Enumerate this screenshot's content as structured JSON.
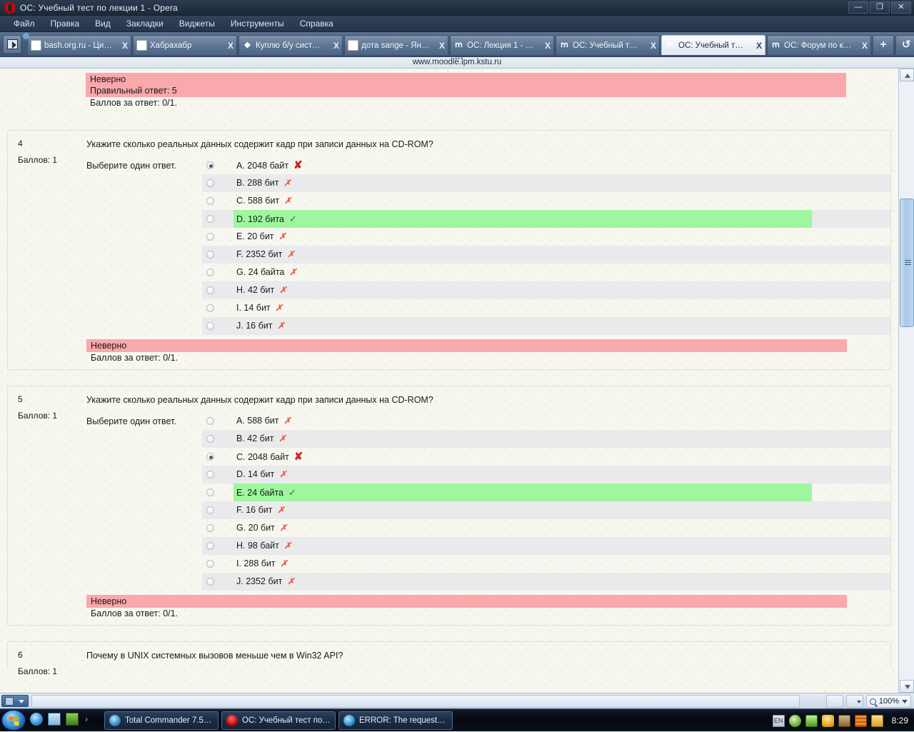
{
  "window": {
    "title": "ОС: Учебный тест по лекции 1 - Opera",
    "minimize": "—",
    "maximize": "❐",
    "close": "✕"
  },
  "menubar": [
    "Файл",
    "Правка",
    "Вид",
    "Закладки",
    "Виджеты",
    "Инструменты",
    "Справка"
  ],
  "tabs": [
    {
      "favicon": "b",
      "favclass": "fav-bash",
      "label": "bash.org.ru - Ци…",
      "close": "X",
      "active": false
    },
    {
      "favicon": "H",
      "favclass": "fav-habr",
      "label": "Хабрахабр",
      "close": "X",
      "active": false
    },
    {
      "favicon": "◆",
      "favclass": "fav-blue",
      "label": "Куплю б/у сист…",
      "close": "X",
      "active": false
    },
    {
      "favicon": "Я",
      "favclass": "fav-ya",
      "label": "дота sange - Ян…",
      "close": "X",
      "active": false
    },
    {
      "favicon": "ⅿ",
      "favclass": "fav-moodle",
      "label": "ОС: Лекция 1 - …",
      "close": "X",
      "active": false
    },
    {
      "favicon": "ⅿ",
      "favclass": "fav-moodle",
      "label": "ОС: Учебный т…",
      "close": "X",
      "active": false
    },
    {
      "favicon": "ⅿ",
      "favclass": "fav-moodle",
      "label": "ОС: Учебный т…",
      "close": "X",
      "active": true
    },
    {
      "favicon": "ⅿ",
      "favclass": "fav-moodle",
      "label": "ОС: Форум по к…",
      "close": "X",
      "active": false
    }
  ],
  "tab_controls": {
    "new_tab": "+",
    "trash": "↺",
    "panel_toggle": "panel-icon"
  },
  "address": {
    "url": "www.moodle.ipm.kstu.ru",
    "dots": "•••"
  },
  "quiz": {
    "labels": {
      "grade_prefix": "Баллов:",
      "choose_one": "Выберите один ответ.",
      "incorrect": "Неверно",
      "correct_answer_prefix": "Правильный ответ:",
      "points_prefix": "Баллов за ответ:"
    },
    "previous_feedback": {
      "verdict": "Неверно",
      "correct_answer": "Правильный ответ: 5",
      "points": "Баллов за ответ: 0/1."
    },
    "questions": [
      {
        "number": "4",
        "grade": "Баллов: 1",
        "text": "Укажите сколько реальных данных содержит кадр при записи данных на CD-ROM?",
        "choose_label": "Выберите один ответ.",
        "options": [
          {
            "label": "A. 2048 байт",
            "selected": true,
            "state": "wrong-big",
            "mark": "✘",
            "shaded": false
          },
          {
            "label": "B. 288 бит",
            "selected": false,
            "state": "wrong-sm",
            "mark": "✗",
            "shaded": true
          },
          {
            "label": "C. 588 бит",
            "selected": false,
            "state": "wrong-sm",
            "mark": "✗",
            "shaded": false
          },
          {
            "label": "D. 192 бита",
            "selected": false,
            "state": "correct",
            "mark": "✓",
            "shaded": true
          },
          {
            "label": "E. 20 бит",
            "selected": false,
            "state": "wrong-sm",
            "mark": "✗",
            "shaded": false
          },
          {
            "label": "F. 2352 бит",
            "selected": false,
            "state": "wrong-sm",
            "mark": "✗",
            "shaded": true
          },
          {
            "label": "G. 24 байта",
            "selected": false,
            "state": "wrong-sm",
            "mark": "✗",
            "shaded": false
          },
          {
            "label": "H. 42 бит",
            "selected": false,
            "state": "wrong-sm",
            "mark": "✗",
            "shaded": true
          },
          {
            "label": "I. 14 бит",
            "selected": false,
            "state": "wrong-sm",
            "mark": "✗",
            "shaded": false
          },
          {
            "label": "J. 16 бит",
            "selected": false,
            "state": "wrong-sm",
            "mark": "✗",
            "shaded": true
          }
        ],
        "feedback": {
          "verdict": "Неверно",
          "points": "Баллов за ответ: 0/1."
        }
      },
      {
        "number": "5",
        "grade": "Баллов: 1",
        "text": "Укажите сколько реальных данных содержит кадр при записи данных на CD-ROM?",
        "choose_label": "Выберите один ответ.",
        "options": [
          {
            "label": "A. 588 бит",
            "selected": false,
            "state": "wrong-sm",
            "mark": "✗",
            "shaded": false
          },
          {
            "label": "B. 42 бит",
            "selected": false,
            "state": "wrong-sm",
            "mark": "✗",
            "shaded": true
          },
          {
            "label": "C. 2048 байт",
            "selected": true,
            "state": "wrong-big",
            "mark": "✘",
            "shaded": false
          },
          {
            "label": "D. 14 бит",
            "selected": false,
            "state": "wrong-sm",
            "mark": "✗",
            "shaded": true
          },
          {
            "label": "E. 24 байта",
            "selected": false,
            "state": "correct",
            "mark": "✓",
            "shaded": false
          },
          {
            "label": "F. 16 бит",
            "selected": false,
            "state": "wrong-sm",
            "mark": "✗",
            "shaded": true
          },
          {
            "label": "G. 20 бит",
            "selected": false,
            "state": "wrong-sm",
            "mark": "✗",
            "shaded": false
          },
          {
            "label": "H. 98 байт",
            "selected": false,
            "state": "wrong-sm",
            "mark": "✗",
            "shaded": true
          },
          {
            "label": "I. 288 бит",
            "selected": false,
            "state": "wrong-sm",
            "mark": "✗",
            "shaded": false
          },
          {
            "label": "J. 2352 бит",
            "selected": false,
            "state": "wrong-sm",
            "mark": "✗",
            "shaded": true
          }
        ],
        "feedback": {
          "verdict": "Неверно",
          "points": "Баллов за ответ: 0/1."
        }
      },
      {
        "number": "6",
        "grade": "Баллов: 1",
        "text": "Почему в UNIX системных вызовов меньше чем в Win32 API?",
        "choose_label": "",
        "options": [],
        "feedback": null
      }
    ]
  },
  "statusbar": {
    "zoom": "100%",
    "zoom_icon": "magnifier-icon",
    "image_icon": "image-toggle-icon",
    "transfer_icon": "transfer-icon"
  },
  "taskbar": {
    "start": "windows-start-orb",
    "quicklaunch": [
      {
        "name": "internet-explorer-icon"
      },
      {
        "name": "show-desktop-icon"
      },
      {
        "name": "utorrent-icon"
      }
    ],
    "quicklaunch_more": "›",
    "tasks": [
      {
        "icon": "total-commander-icon",
        "label": "Total Commander 7.5…"
      },
      {
        "icon": "opera-icon",
        "label": "ОС: Учебный тест по…"
      },
      {
        "icon": "internet-explorer-icon",
        "label": "ERROR: The requeste…"
      }
    ],
    "tray": {
      "language": "EN",
      "icons": [
        "shield-icon",
        "utorrent-icon",
        "security-alert-icon",
        "download-icon",
        "drive-icon",
        "folder-icon"
      ],
      "clock": "8:29"
    }
  },
  "colors": {
    "incorrect_bg": "#f9a8ac",
    "correct_bg": "#9ef79e",
    "wrong_mark": "#d32020",
    "ok_mark": "#2a7d2a",
    "page_bg": "#f7f7f0",
    "row_shade": "#e9eaec"
  }
}
